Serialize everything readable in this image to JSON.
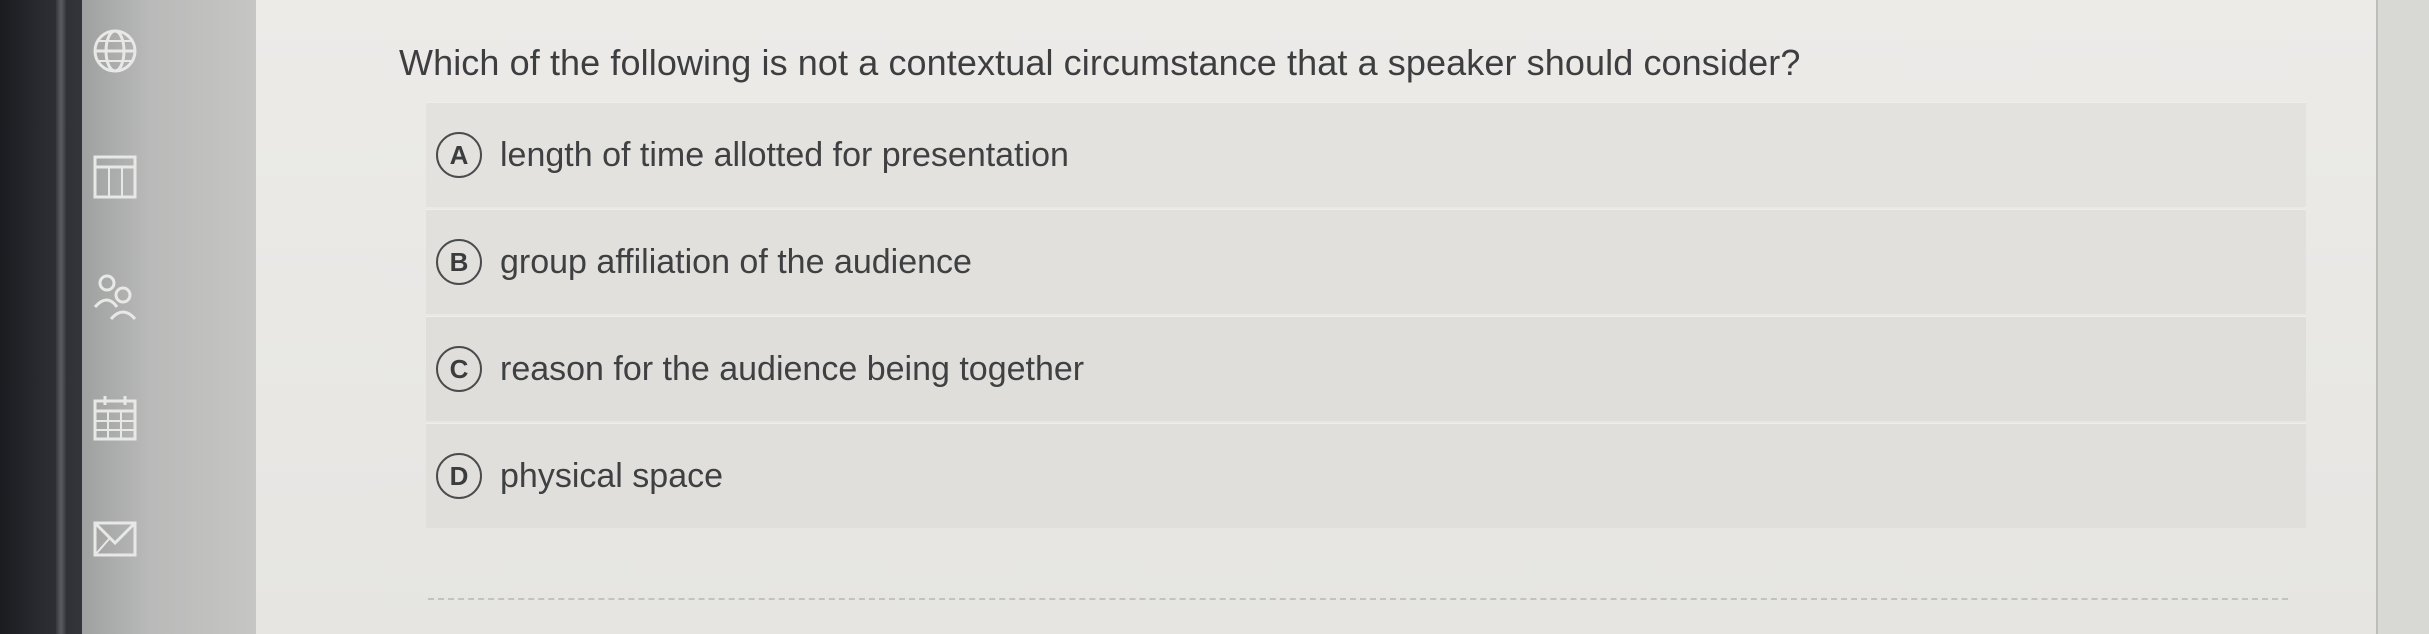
{
  "question": {
    "text": "Which of the following is not a contextual circumstance that a speaker should consider?"
  },
  "options": [
    {
      "letter": "A",
      "text": "length of time allotted for presentation"
    },
    {
      "letter": "B",
      "text": "group affiliation of the audience"
    },
    {
      "letter": "C",
      "text": "reason for the audience being together"
    },
    {
      "letter": "D",
      "text": "physical space"
    }
  ],
  "sidebar": {
    "icons": [
      "globe-icon",
      "calendar-grid-icon",
      "people-icon",
      "calendar-icon",
      "mail-icon"
    ]
  },
  "colors": {
    "sidebar": "#2b2c31",
    "card": "#ecebe8",
    "text": "#3d3e40"
  }
}
